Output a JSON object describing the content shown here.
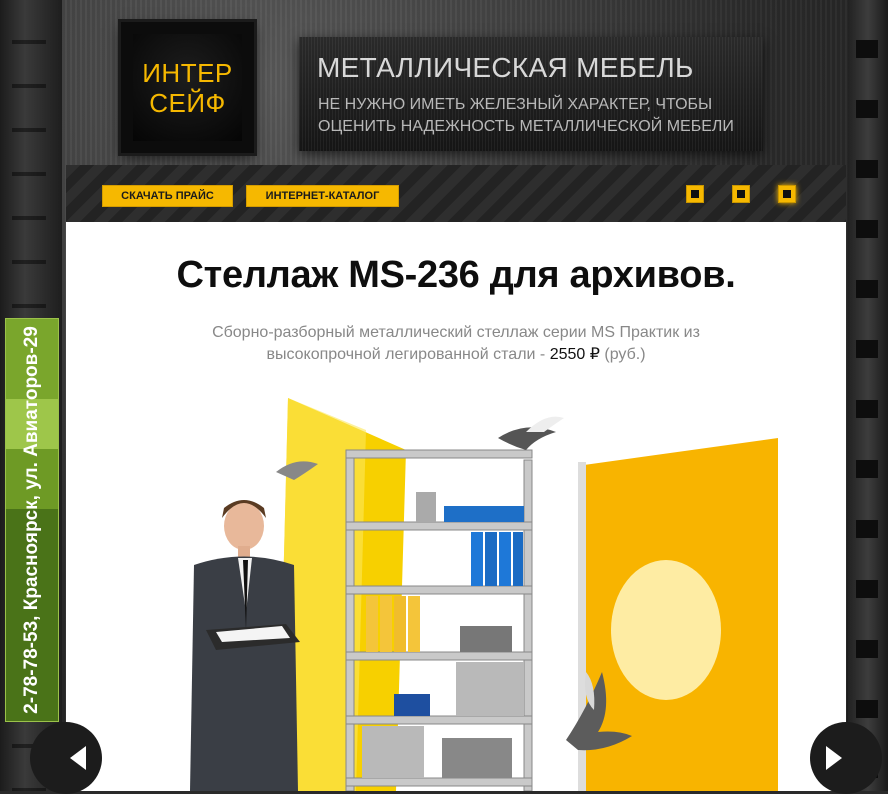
{
  "logo": {
    "line1": "ИНТЕР",
    "line2": "СЕЙФ"
  },
  "slogan": {
    "title": "МЕТАЛЛИЧЕСКАЯ МЕБЕЛЬ",
    "subtitle": "НЕ НУЖНО ИМЕТЬ ЖЕЛЕЗНЫЙ ХАРАКТЕР, ЧТОБЫ ОЦЕНИТЬ НАДЕЖНОСТЬ МЕТАЛЛИЧЕСКОЙ МЕБЕЛИ"
  },
  "nav": {
    "price_button": "СКАЧАТЬ ПРАЙС",
    "catalog_button": "ИНТЕРНЕТ-КАТАЛОГ"
  },
  "slider": {
    "count": 3,
    "active": 3
  },
  "product": {
    "title": "Стеллаж MS-236 для архивов.",
    "description": "Сборно-разборный металлический стеллаж серии MS Практик из высокопрочной легированной стали -",
    "price": "2550 ₽",
    "currency": "(руб.)"
  },
  "contact": {
    "text": "2-78-78-53, Красноярск, ул. Авиаторов-29"
  },
  "colors": {
    "accent": "#f6b800",
    "green": "#7aa62c"
  },
  "icons": {
    "prev": "chevron-left-icon",
    "next": "chevron-right-icon"
  }
}
